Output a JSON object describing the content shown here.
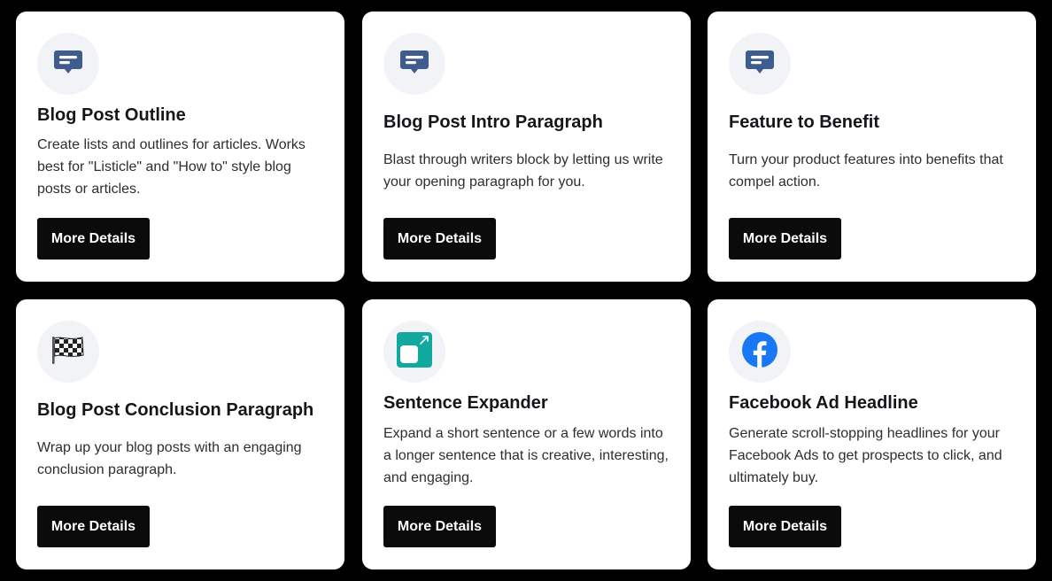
{
  "cards": [
    {
      "icon": "message-icon",
      "title": "Blog Post Outline",
      "description": "Create lists and outlines for articles. Works best for \"Listicle\" and \"How to\" style blog posts or articles.",
      "button": "More Details"
    },
    {
      "icon": "message-icon",
      "title": "Blog Post Intro Paragraph",
      "description": "Blast through writers block by letting us write your opening paragraph for you.",
      "button": "More Details"
    },
    {
      "icon": "message-icon",
      "title": "Feature to Benefit",
      "description": "Turn your product features into benefits that compel action.",
      "button": "More Details"
    },
    {
      "icon": "checkered-flag-icon",
      "title": "Blog Post Conclusion Paragraph",
      "description": "Wrap up your blog posts with an engaging conclusion paragraph.",
      "button": "More Details"
    },
    {
      "icon": "expand-icon",
      "title": "Sentence Expander",
      "description": "Expand a short sentence or a few words into a longer sentence that is creative, interesting, and engaging.",
      "button": "More Details"
    },
    {
      "icon": "facebook-icon",
      "title": "Facebook Ad Headline",
      "description": "Generate scroll-stopping headlines for your Facebook Ads to get prospects to click, and ultimately buy.",
      "button": "More Details"
    }
  ],
  "colors": {
    "message_icon": "#3f5c8f",
    "expand_icon": "#13a89e",
    "facebook_icon": "#1877f2",
    "button_bg": "#0b0b0b"
  }
}
